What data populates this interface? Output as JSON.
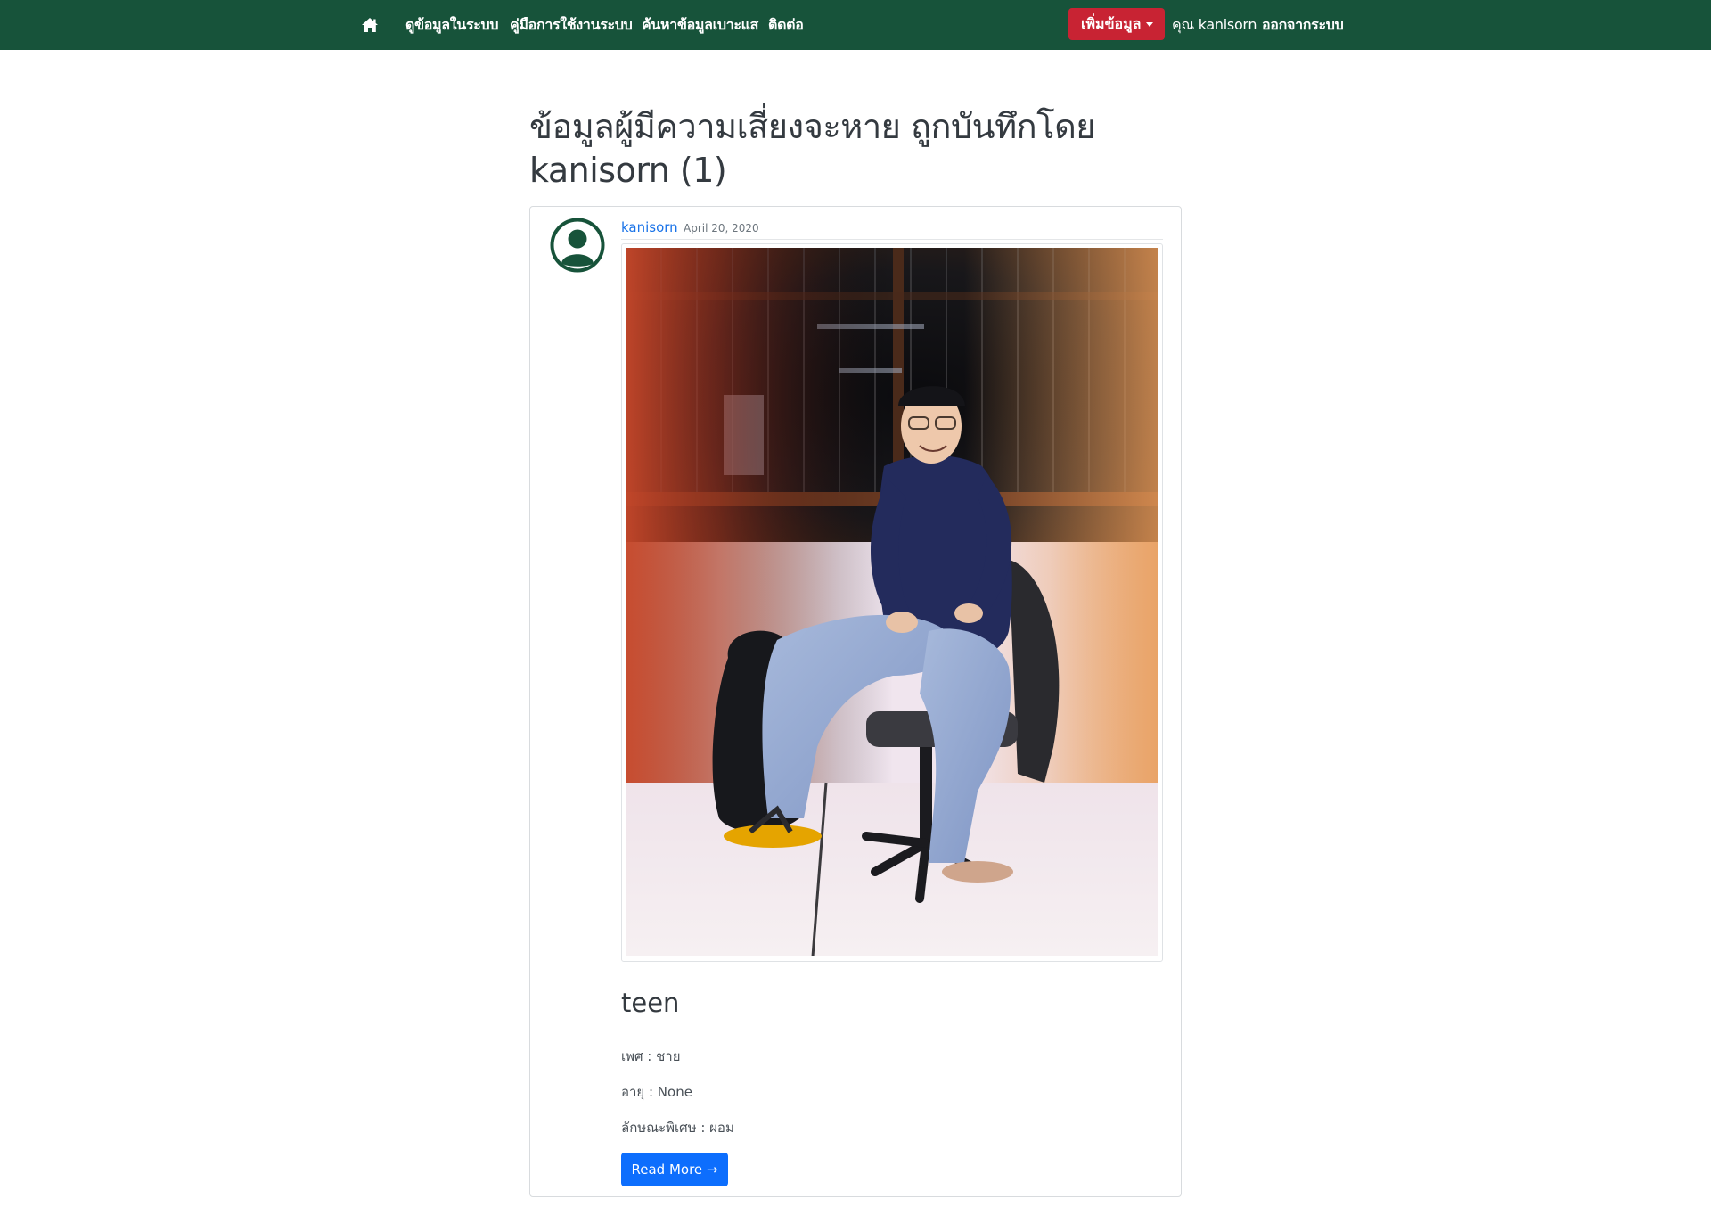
{
  "navbar": {
    "home_icon": "home-icon",
    "links": [
      {
        "label": "ดูข้อมูลในระบบ"
      },
      {
        "label": "คู่มือการใช้งานระบบ"
      },
      {
        "label": "ค้นหาข้อมูลเบาะแส"
      },
      {
        "label": "ติดต่อ"
      }
    ],
    "add_button_label": "เพิ่มข้อมูล",
    "user_label": "คุณ kanisorn",
    "logout_label": "ออกจากระบบ"
  },
  "page": {
    "title_line1": "ข้อมูลผู้มีความเสี่ยงจะหาย ถูกบันทึกโดย",
    "title_line2": "kanisorn (1)"
  },
  "post": {
    "avatar_icon": "user-circle-icon",
    "author": "kanisorn",
    "date": "April 20, 2020",
    "title": "teen",
    "fields": [
      {
        "text": "เพศ : ชาย"
      },
      {
        "text": "อายุ : None"
      },
      {
        "text": "ลักษณะพิเศษ : ผอม"
      }
    ],
    "read_more_label": "Read More →"
  },
  "colors": {
    "navbar_bg": "#17533a",
    "add_button_bg": "#c82333",
    "primary": "#0d6efd",
    "link": "#1a73e8"
  }
}
